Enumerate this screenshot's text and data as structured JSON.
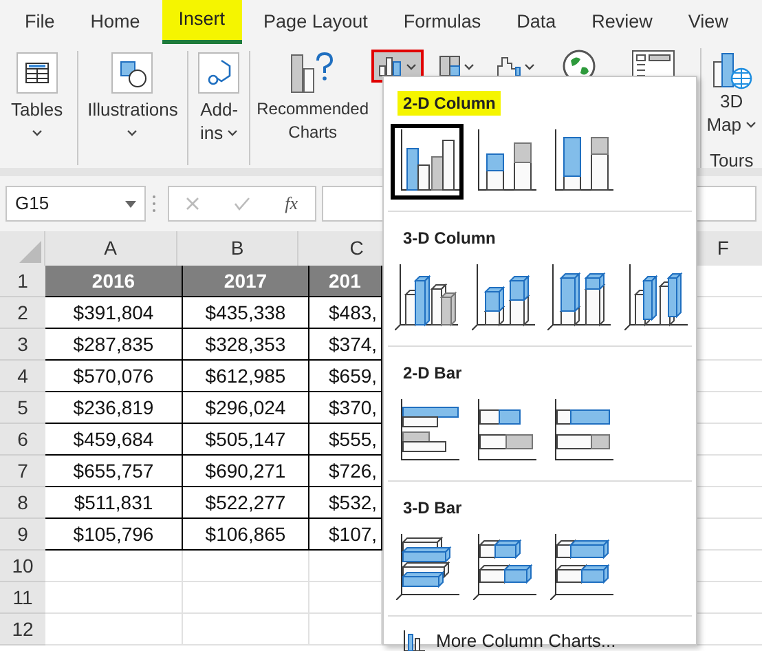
{
  "tabs": [
    {
      "label": "File",
      "selected": false
    },
    {
      "label": "Home",
      "selected": false
    },
    {
      "label": "Insert",
      "selected": true
    },
    {
      "label": "Page Layout",
      "selected": false
    },
    {
      "label": "Formulas",
      "selected": false
    },
    {
      "label": "Data",
      "selected": false
    },
    {
      "label": "Review",
      "selected": false
    },
    {
      "label": "View",
      "selected": false
    }
  ],
  "ribbon": {
    "buttons": [
      {
        "kind": "tables",
        "label_lines": [
          "Tables"
        ],
        "caret": true
      },
      {
        "kind": "illustrations",
        "label_lines": [
          "Illustrations"
        ],
        "caret": true
      },
      {
        "kind": "addins",
        "label_lines": [
          "Add-",
          "ins"
        ],
        "caret": true
      },
      {
        "kind": "recommended",
        "label_lines": [
          "Recommended",
          "Charts"
        ],
        "caret": false
      }
    ],
    "chart_buttons": [
      {
        "kind": "column",
        "selected": true
      },
      {
        "kind": "hierarchy",
        "selected": false
      },
      {
        "kind": "waterfall",
        "selected": false
      },
      {
        "kind": "map",
        "selected": false
      },
      {
        "kind": "pivot",
        "selected": false
      }
    ],
    "map3d": {
      "label_lines": [
        "3D",
        "Map"
      ],
      "group": "Tours"
    }
  },
  "formula_bar": {
    "name_box": "G15",
    "function_label": "fx"
  },
  "sheet": {
    "columns": [
      "A",
      "B",
      "C",
      "F"
    ],
    "rows": [
      {
        "number": "1",
        "kind": "header",
        "cells": [
          "2016",
          "2017",
          "201"
        ]
      },
      {
        "number": "2",
        "kind": "data",
        "cells": [
          "$391,804",
          "$435,338",
          "$483,"
        ]
      },
      {
        "number": "3",
        "kind": "data",
        "cells": [
          "$287,835",
          "$328,353",
          "$374,"
        ]
      },
      {
        "number": "4",
        "kind": "data",
        "cells": [
          "$570,076",
          "$612,985",
          "$659,"
        ]
      },
      {
        "number": "5",
        "kind": "data",
        "cells": [
          "$236,819",
          "$296,024",
          "$370,"
        ]
      },
      {
        "number": "6",
        "kind": "data",
        "cells": [
          "$459,684",
          "$505,147",
          "$555,"
        ]
      },
      {
        "number": "7",
        "kind": "data",
        "cells": [
          "$655,757",
          "$690,271",
          "$726,"
        ]
      },
      {
        "number": "8",
        "kind": "data",
        "cells": [
          "$511,831",
          "$522,277",
          "$532,"
        ]
      },
      {
        "number": "9",
        "kind": "data",
        "cells": [
          "$105,796",
          "$106,865",
          "$107,"
        ]
      },
      {
        "number": "10",
        "kind": "empty",
        "cells": []
      },
      {
        "number": "11",
        "kind": "empty",
        "cells": []
      },
      {
        "number": "12",
        "kind": "empty",
        "cells": []
      }
    ]
  },
  "menu": {
    "sections": [
      {
        "title": "2-D Column",
        "highlighted": true,
        "kind": "column2d",
        "items": [
          {
            "kind": "clustered",
            "selected": true
          },
          {
            "kind": "stacked",
            "selected": false
          },
          {
            "kind": "percent",
            "selected": false
          }
        ]
      },
      {
        "title": "3-D Column",
        "highlighted": false,
        "kind": "column3d",
        "items": [
          {
            "kind": "clustered",
            "selected": false
          },
          {
            "kind": "stacked",
            "selected": false
          },
          {
            "kind": "percent",
            "selected": false
          },
          {
            "kind": "threed",
            "selected": false
          }
        ]
      },
      {
        "title": "2-D Bar",
        "highlighted": false,
        "kind": "bar2d",
        "items": [
          {
            "kind": "clustered",
            "selected": false
          },
          {
            "kind": "stacked",
            "selected": false
          },
          {
            "kind": "percent",
            "selected": false
          }
        ]
      },
      {
        "title": "3-D Bar",
        "highlighted": false,
        "kind": "bar3d",
        "items": [
          {
            "kind": "clustered",
            "selected": false
          },
          {
            "kind": "stacked",
            "selected": false
          },
          {
            "kind": "percent",
            "selected": false
          }
        ]
      }
    ],
    "footer": "More Column Charts..."
  }
}
